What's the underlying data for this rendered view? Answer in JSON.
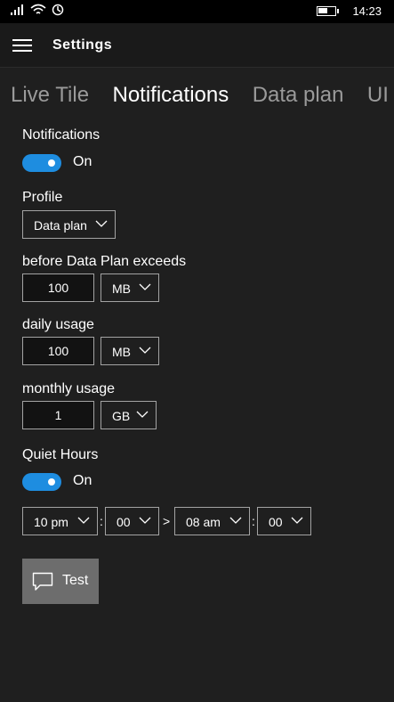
{
  "status_bar": {
    "time": "14:23",
    "icons": [
      "signal-icon",
      "wifi-icon",
      "data-saver-icon",
      "battery-icon"
    ],
    "battery_fraction": 0.6
  },
  "app": {
    "title": "Settings"
  },
  "pivot": {
    "items": [
      "Live Tile",
      "Notifications",
      "Data plan",
      "UI"
    ],
    "active": 1
  },
  "notifications": {
    "label": "Notifications",
    "toggle_state": "On"
  },
  "profile": {
    "label": "Profile",
    "selected": "Data plan"
  },
  "before_exceeds": {
    "label": "before Data Plan exceeds",
    "value": "100",
    "unit": "MB"
  },
  "daily": {
    "label": "daily usage",
    "value": "100",
    "unit": "MB"
  },
  "monthly": {
    "label": "monthly usage",
    "value": "1",
    "unit": "GB"
  },
  "quiet_hours": {
    "label": "Quiet Hours",
    "toggle_state": "On",
    "start_hour": "10 pm",
    "start_min": "00",
    "end_hour": "08 am",
    "end_min": "00",
    "colon": ":",
    "arrow": ">"
  },
  "test_button": {
    "label": "Test"
  },
  "colors": {
    "accent": "#1e8de0",
    "background": "#1f1f1f",
    "button": "#6d6d6d"
  }
}
